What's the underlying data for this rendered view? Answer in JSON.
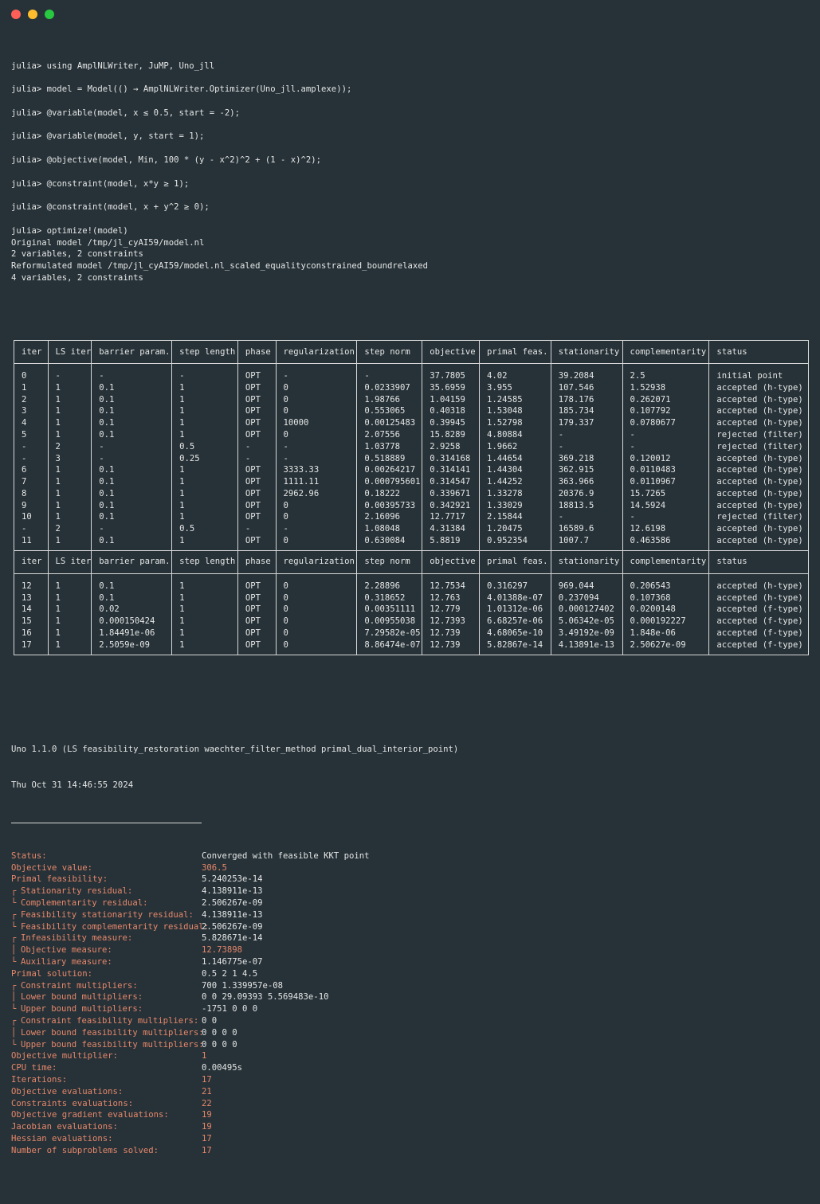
{
  "window": {
    "controls": [
      {
        "name": "close",
        "color": "#ff5f57"
      },
      {
        "name": "minimize",
        "color": "#febc2e"
      },
      {
        "name": "maximize",
        "color": "#28c840"
      }
    ]
  },
  "session": [
    {
      "type": "cmd",
      "text": "julia> using AmplNLWriter, JuMP, Uno_jll"
    },
    {
      "type": "gap"
    },
    {
      "type": "cmd",
      "text": "julia> model = Model(() → AmplNLWriter.Optimizer(Uno_jll.amplexe));"
    },
    {
      "type": "gap"
    },
    {
      "type": "cmd",
      "text": "julia> @variable(model, x ≤ 0.5, start = -2);"
    },
    {
      "type": "gap"
    },
    {
      "type": "cmd",
      "text": "julia> @variable(model, y, start = 1);"
    },
    {
      "type": "gap"
    },
    {
      "type": "cmd",
      "text": "julia> @objective(model, Min, 100 * (y - x^2)^2 + (1 - x)^2);"
    },
    {
      "type": "gap"
    },
    {
      "type": "cmd",
      "text": "julia> @constraint(model, x*y ≥ 1);"
    },
    {
      "type": "gap"
    },
    {
      "type": "cmd",
      "text": "julia> @constraint(model, x + y^2 ≥ 0);"
    },
    {
      "type": "gap"
    },
    {
      "type": "cmd",
      "text": "julia> optimize!(model)"
    },
    {
      "type": "out",
      "text": "Original model /tmp/jl_cyAI59/model.nl"
    },
    {
      "type": "out",
      "text": "2 variables, 2 constraints"
    },
    {
      "type": "out",
      "text": "Reformulated model /tmp/jl_cyAI59/model.nl_scaled_equalityconstrained_boundrelaxed"
    },
    {
      "type": "out",
      "text": "4 variables, 2 constraints"
    }
  ],
  "table": {
    "headers": [
      "iter",
      "LS iter",
      "barrier param.",
      "step length",
      "phase",
      "regularization",
      "step norm",
      "objective",
      "primal feas.",
      "stationarity",
      "complementarity",
      "status"
    ],
    "col_widths": [
      43,
      53,
      101,
      83,
      48,
      102,
      82,
      72,
      90,
      90,
      109,
      125
    ],
    "blocks": [
      [
        [
          "0",
          "-",
          "-",
          "-",
          "OPT",
          "-",
          "-",
          "37.7805",
          "4.02",
          "39.2084",
          "2.5",
          "initial point"
        ],
        [
          "1",
          "1",
          "0.1",
          "1",
          "OPT",
          "0",
          "0.0233907",
          "35.6959",
          "3.955",
          "107.546",
          "1.52938",
          "accepted (h-type)"
        ],
        [
          "2",
          "1",
          "0.1",
          "1",
          "OPT",
          "0",
          "1.98766",
          "1.04159",
          "1.24585",
          "178.176",
          "0.262071",
          "accepted (h-type)"
        ],
        [
          "3",
          "1",
          "0.1",
          "1",
          "OPT",
          "0",
          "0.553065",
          "0.40318",
          "1.53048",
          "185.734",
          "0.107792",
          "accepted (h-type)"
        ],
        [
          "4",
          "1",
          "0.1",
          "1",
          "OPT",
          "10000",
          "0.00125483",
          "0.39945",
          "1.52798",
          "179.337",
          "0.0780677",
          "accepted (h-type)"
        ],
        [
          "5",
          "1",
          "0.1",
          "1",
          "OPT",
          "0",
          "2.07556",
          "15.8289",
          "4.80884",
          "-",
          "-",
          "rejected (filter)"
        ],
        [
          "-",
          "2",
          "-",
          "0.5",
          "-",
          "-",
          "1.03778",
          "2.9258",
          "1.9662",
          "-",
          "-",
          "rejected (filter)"
        ],
        [
          "-",
          "3",
          "-",
          "0.25",
          "-",
          "-",
          "0.518889",
          "0.314168",
          "1.44654",
          "369.218",
          "0.120012",
          "accepted (h-type)"
        ],
        [
          "6",
          "1",
          "0.1",
          "1",
          "OPT",
          "3333.33",
          "0.00264217",
          "0.314141",
          "1.44304",
          "362.915",
          "0.0110483",
          "accepted (h-type)"
        ],
        [
          "7",
          "1",
          "0.1",
          "1",
          "OPT",
          "1111.11",
          "0.000795601",
          "0.314547",
          "1.44252",
          "363.966",
          "0.0110967",
          "accepted (h-type)"
        ],
        [
          "8",
          "1",
          "0.1",
          "1",
          "OPT",
          "2962.96",
          "0.18222",
          "0.339671",
          "1.33278",
          "20376.9",
          "15.7265",
          "accepted (h-type)"
        ],
        [
          "9",
          "1",
          "0.1",
          "1",
          "OPT",
          "0",
          "0.00395733",
          "0.342921",
          "1.33029",
          "18813.5",
          "14.5924",
          "accepted (h-type)"
        ],
        [
          "10",
          "1",
          "0.1",
          "1",
          "OPT",
          "0",
          "2.16096",
          "12.7717",
          "2.15844",
          "-",
          "-",
          "rejected (filter)"
        ],
        [
          "-",
          "2",
          "-",
          "0.5",
          "-",
          "-",
          "1.08048",
          "4.31384",
          "1.20475",
          "16589.6",
          "12.6198",
          "accepted (h-type)"
        ],
        [
          "11",
          "1",
          "0.1",
          "1",
          "OPT",
          "0",
          "0.630084",
          "5.8819",
          "0.952354",
          "1007.7",
          "0.463586",
          "accepted (h-type)"
        ]
      ],
      [
        [
          "12",
          "1",
          "0.1",
          "1",
          "OPT",
          "0",
          "2.28896",
          "12.7534",
          "0.316297",
          "969.044",
          "0.206543",
          "accepted (h-type)"
        ],
        [
          "13",
          "1",
          "0.1",
          "1",
          "OPT",
          "0",
          "0.318652",
          "12.763",
          "4.01388e-07",
          "0.237094",
          "0.107368",
          "accepted (h-type)"
        ],
        [
          "14",
          "1",
          "0.02",
          "1",
          "OPT",
          "0",
          "0.00351111",
          "12.779",
          "1.01312e-06",
          "0.000127402",
          "0.0200148",
          "accepted (f-type)"
        ],
        [
          "15",
          "1",
          "0.000150424",
          "1",
          "OPT",
          "0",
          "0.00955038",
          "12.7393",
          "6.68257e-06",
          "5.06342e-05",
          "0.000192227",
          "accepted (f-type)"
        ],
        [
          "16",
          "1",
          "1.84491e-06",
          "1",
          "OPT",
          "0",
          "7.29582e-05",
          "12.739",
          "4.68065e-10",
          "3.49192e-09",
          "1.848e-06",
          "accepted (f-type)"
        ],
        [
          "17",
          "1",
          "2.5059e-09",
          "1",
          "OPT",
          "0",
          "8.86474e-07",
          "12.739",
          "5.82867e-14",
          "4.13891e-13",
          "2.50627e-09",
          "accepted (f-type)"
        ]
      ]
    ]
  },
  "footer": {
    "header_lines": [
      "Uno 1.1.0 (LS feasibility_restoration waechter_filter_method primal_dual_interior_point)",
      "Thu Oct 31 14:46:55 2024"
    ],
    "results": [
      {
        "bracket": "",
        "key": "Status:",
        "value": "Converged with feasible KKT point",
        "hl": false
      },
      {
        "bracket": "",
        "key": "Objective value:",
        "value": "306.5",
        "hl": true
      },
      {
        "bracket": "",
        "key": "Primal feasibility:",
        "value": "5.240253e-14",
        "hl": false
      },
      {
        "bracket": "┌",
        "key": "Stationarity residual:",
        "value": "4.138911e-13",
        "hl": false
      },
      {
        "bracket": "└",
        "key": "Complementarity residual:",
        "value": "2.506267e-09",
        "hl": false
      },
      {
        "bracket": "┌",
        "key": "Feasibility stationarity residual:",
        "value": "4.138911e-13",
        "hl": false
      },
      {
        "bracket": "└",
        "key": "Feasibility complementarity residual:",
        "value": "2.506267e-09",
        "hl": false
      },
      {
        "bracket": "┌",
        "key": "Infeasibility measure:",
        "value": "5.828671e-14",
        "hl": false
      },
      {
        "bracket": "│",
        "key": "Objective measure:",
        "value": "12.73898",
        "hl": true
      },
      {
        "bracket": "└",
        "key": "Auxiliary measure:",
        "value": "1.146775e-07",
        "hl": false
      },
      {
        "bracket": "",
        "key": "Primal solution:",
        "value": "0.5 2 1 4.5",
        "hl": false
      },
      {
        "bracket": "┌",
        "key": "Constraint multipliers:",
        "value": "700 1.339957e-08",
        "hl": false
      },
      {
        "bracket": "│",
        "key": "Lower bound multipliers:",
        "value": "0 0 29.09393 5.569483e-10",
        "hl": false
      },
      {
        "bracket": "└",
        "key": "Upper bound multipliers:",
        "value": "-1751 0 0 0",
        "hl": false
      },
      {
        "bracket": "┌",
        "key": "Constraint feasibility multipliers:",
        "value": "0 0",
        "hl": false
      },
      {
        "bracket": "│",
        "key": "Lower bound feasibility multipliers:",
        "value": "0 0 0 0",
        "hl": false
      },
      {
        "bracket": "└",
        "key": "Upper bound feasibility multipliers:",
        "value": "0 0 0 0",
        "hl": false
      },
      {
        "bracket": "",
        "key": "Objective multiplier:",
        "value": "1",
        "hl": true
      },
      {
        "bracket": "",
        "key": "CPU time:",
        "value": "0.00495s",
        "hl": false
      },
      {
        "bracket": "",
        "key": "Iterations:",
        "value": "17",
        "hl": true
      },
      {
        "bracket": "",
        "key": "Objective evaluations:",
        "value": "21",
        "hl": true
      },
      {
        "bracket": "",
        "key": "Constraints evaluations:",
        "value": "22",
        "hl": true
      },
      {
        "bracket": "",
        "key": "Objective gradient evaluations:",
        "value": "19",
        "hl": true
      },
      {
        "bracket": "",
        "key": "Jacobian evaluations:",
        "value": "19",
        "hl": true
      },
      {
        "bracket": "",
        "key": "Hessian evaluations:",
        "value": "17",
        "hl": true
      },
      {
        "bracket": "",
        "key": "Number of subproblems solved:",
        "value": "17",
        "hl": true
      }
    ]
  }
}
